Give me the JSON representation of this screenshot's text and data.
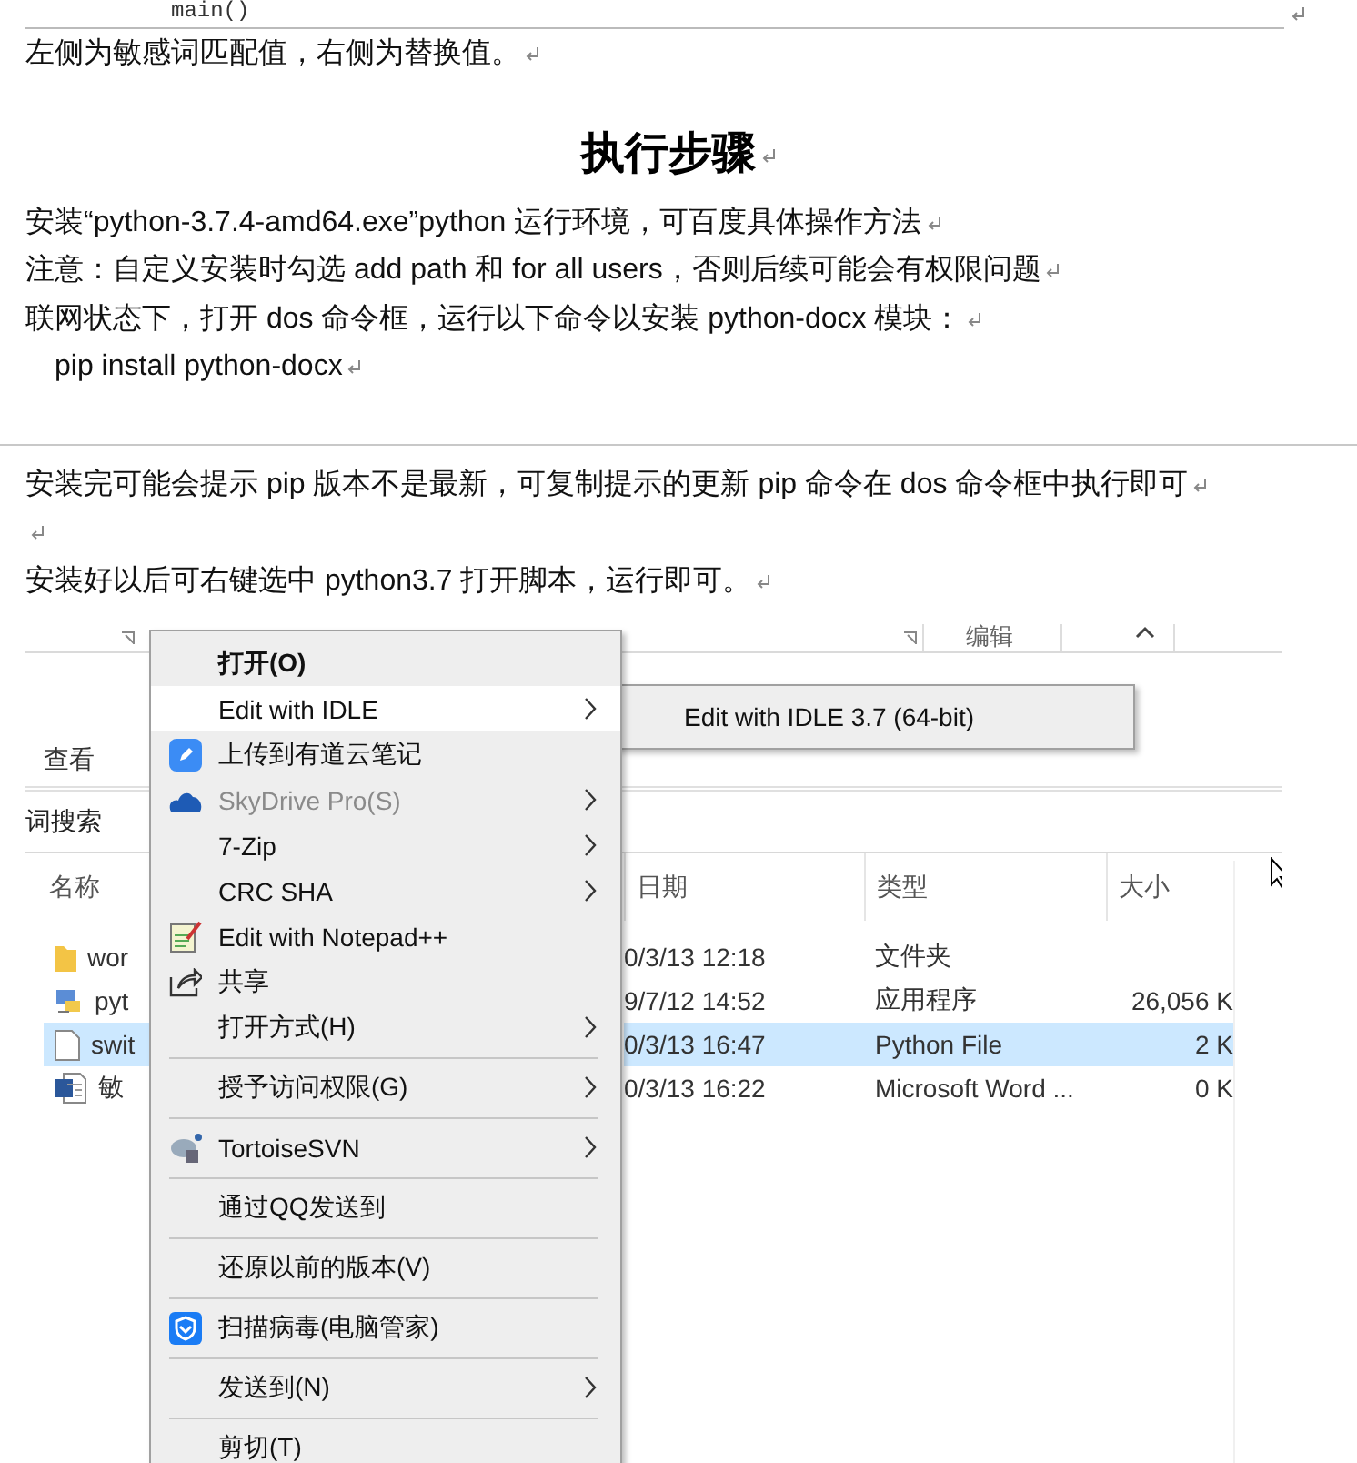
{
  "document": {
    "blocks": [
      {
        "kind": "code",
        "text": "main()"
      },
      {
        "kind": "body",
        "text": "左侧为敏感词匹配值，右侧为替换值。"
      },
      {
        "kind": "heading",
        "text": "执行步骤"
      },
      {
        "kind": "body",
        "text": "安装“python-3.7.4-amd64.exe”python 运行环境，可百度具体操作方法"
      },
      {
        "kind": "body",
        "text": "注意：自定义安装时勾选 add path 和 for all users，否则后续可能会有权限问题"
      },
      {
        "kind": "body",
        "text": "联网状态下，打开 dos 命令框，运行以下命令以安装 python-docx 模块："
      },
      {
        "kind": "indent",
        "text": "pip install python-docx"
      },
      {
        "kind": "page_break"
      },
      {
        "kind": "body",
        "text": "安装完可能会提示 pip 版本不是最新，可复制提示的更新 pip 命令在 dos 命令框中执行即可"
      },
      {
        "kind": "empty"
      },
      {
        "kind": "body",
        "text": "安装好以后可右键选中 python3.7 打开脚本，运行即可。"
      }
    ]
  },
  "screenshot": {
    "ribbon_groups": [
      "编辑"
    ],
    "tabs": [
      {
        "label": "查看",
        "selected": false
      }
    ],
    "location": "词搜索",
    "columns": [
      "名称",
      "日期",
      "类型",
      "大小"
    ],
    "rows": [
      {
        "kind": "folder",
        "name": "wor",
        "date": "0/3/13 12:18",
        "type": "文件夹",
        "selected": false
      },
      {
        "kind": "program",
        "name": "pyt",
        "date": "9/7/12 14:52",
        "type": "应用程序",
        "size": "26,056 K",
        "selected": false
      },
      {
        "kind": "file",
        "name": "swit",
        "date": "0/3/13 16:47",
        "type": "Python File",
        "size": "2 K",
        "selected": true
      },
      {
        "kind": "word",
        "name": "敏",
        "date": "0/3/13 16:22",
        "type": "Microsoft Word ...",
        "size": "0 K",
        "selected": false
      }
    ],
    "context_menu": {
      "items": [
        {
          "kind": "item",
          "label": "打开(O)",
          "default": true,
          "selected": false,
          "disabled": false,
          "submenu": false
        },
        {
          "kind": "item",
          "label": "Edit with IDLE",
          "default": false,
          "selected": true,
          "disabled": false,
          "submenu": true
        },
        {
          "kind": "item",
          "label": "上传到有道云笔记",
          "default": false,
          "selected": false,
          "disabled": false,
          "submenu": false
        },
        {
          "kind": "item",
          "label": "SkyDrive Pro(S)",
          "default": false,
          "selected": false,
          "disabled": true,
          "submenu": true
        },
        {
          "kind": "item",
          "label": "7-Zip",
          "default": false,
          "selected": false,
          "disabled": false,
          "submenu": true
        },
        {
          "kind": "item",
          "label": "CRC SHA",
          "default": false,
          "selected": false,
          "disabled": false,
          "submenu": true
        },
        {
          "kind": "item",
          "label": "Edit with Notepad++",
          "default": false,
          "selected": false,
          "disabled": false,
          "submenu": false
        },
        {
          "kind": "item",
          "label": "共享",
          "default": false,
          "selected": false,
          "disabled": false,
          "submenu": false
        },
        {
          "kind": "item",
          "label": "打开方式(H)",
          "default": false,
          "selected": false,
          "disabled": false,
          "submenu": true
        },
        {
          "kind": "separator"
        },
        {
          "kind": "item",
          "label": "授予访问权限(G)",
          "default": false,
          "selected": false,
          "disabled": false,
          "submenu": true
        },
        {
          "kind": "separator"
        },
        {
          "kind": "item",
          "label": "TortoiseSVN",
          "default": false,
          "selected": false,
          "disabled": false,
          "submenu": true
        },
        {
          "kind": "separator"
        },
        {
          "kind": "item",
          "label": "通过QQ发送到",
          "default": false,
          "selected": false,
          "disabled": false,
          "submenu": false
        },
        {
          "kind": "separator"
        },
        {
          "kind": "item",
          "label": "还原以前的版本(V)",
          "default": false,
          "selected": false,
          "disabled": false,
          "submenu": false
        },
        {
          "kind": "separator"
        },
        {
          "kind": "item",
          "label": "扫描病毒(电脑管家)",
          "default": false,
          "selected": false,
          "disabled": false,
          "submenu": false
        },
        {
          "kind": "separator"
        },
        {
          "kind": "item",
          "label": "发送到(N)",
          "default": false,
          "selected": false,
          "disabled": false,
          "submenu": true
        },
        {
          "kind": "separator"
        },
        {
          "kind": "item",
          "label": "剪切(T)",
          "default": false,
          "selected": false,
          "disabled": false,
          "submenu": false
        }
      ]
    },
    "submenu": {
      "items": [
        {
          "label": "Edit with IDLE 3.7 (64-bit)",
          "selected": false
        }
      ]
    }
  }
}
